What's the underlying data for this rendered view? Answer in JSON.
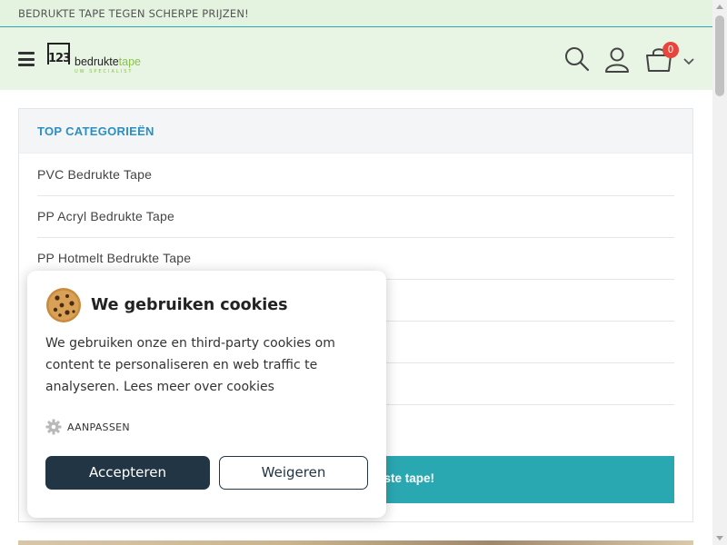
{
  "topbar": {
    "text": "BEDRUKTE TAPE TEGEN SCHERPE PRIJZEN!"
  },
  "header": {
    "logo": {
      "num": "123",
      "word_dark": "bedrukte",
      "word_green": "tape",
      "tagline": "UW SPECIALIST"
    },
    "cart_count": "0",
    "icons": [
      "menu-icon",
      "search-icon",
      "user-icon",
      "cart-icon",
      "chevron-down-icon"
    ]
  },
  "categories": {
    "title": "TOP CATEGORIEËN",
    "items": [
      {
        "label": "PVC Bedrukte Tape"
      },
      {
        "label": "PP Acryl Bedrukte Tape"
      },
      {
        "label": "PP Hotmelt Bedrukte Tape"
      },
      {
        "label": ""
      },
      {
        "label": ""
      },
      {
        "label": ""
      }
    ],
    "cta_label": "ste tape!"
  },
  "cookie": {
    "title": "We gebruiken cookies",
    "text": "We gebruiken onze en third-party cookies om content te personaliseren en web traffic te analyseren. Lees meer over cookies",
    "customize_label": "AANPASSEN",
    "accept_label": "Accepteren",
    "reject_label": "Weigeren"
  },
  "colors": {
    "accent": "#2aa8b1",
    "category_title": "#2a8fc4",
    "accept_bg": "#223544",
    "badge": "#e8453c",
    "header_bg": "#e8f4e4"
  }
}
